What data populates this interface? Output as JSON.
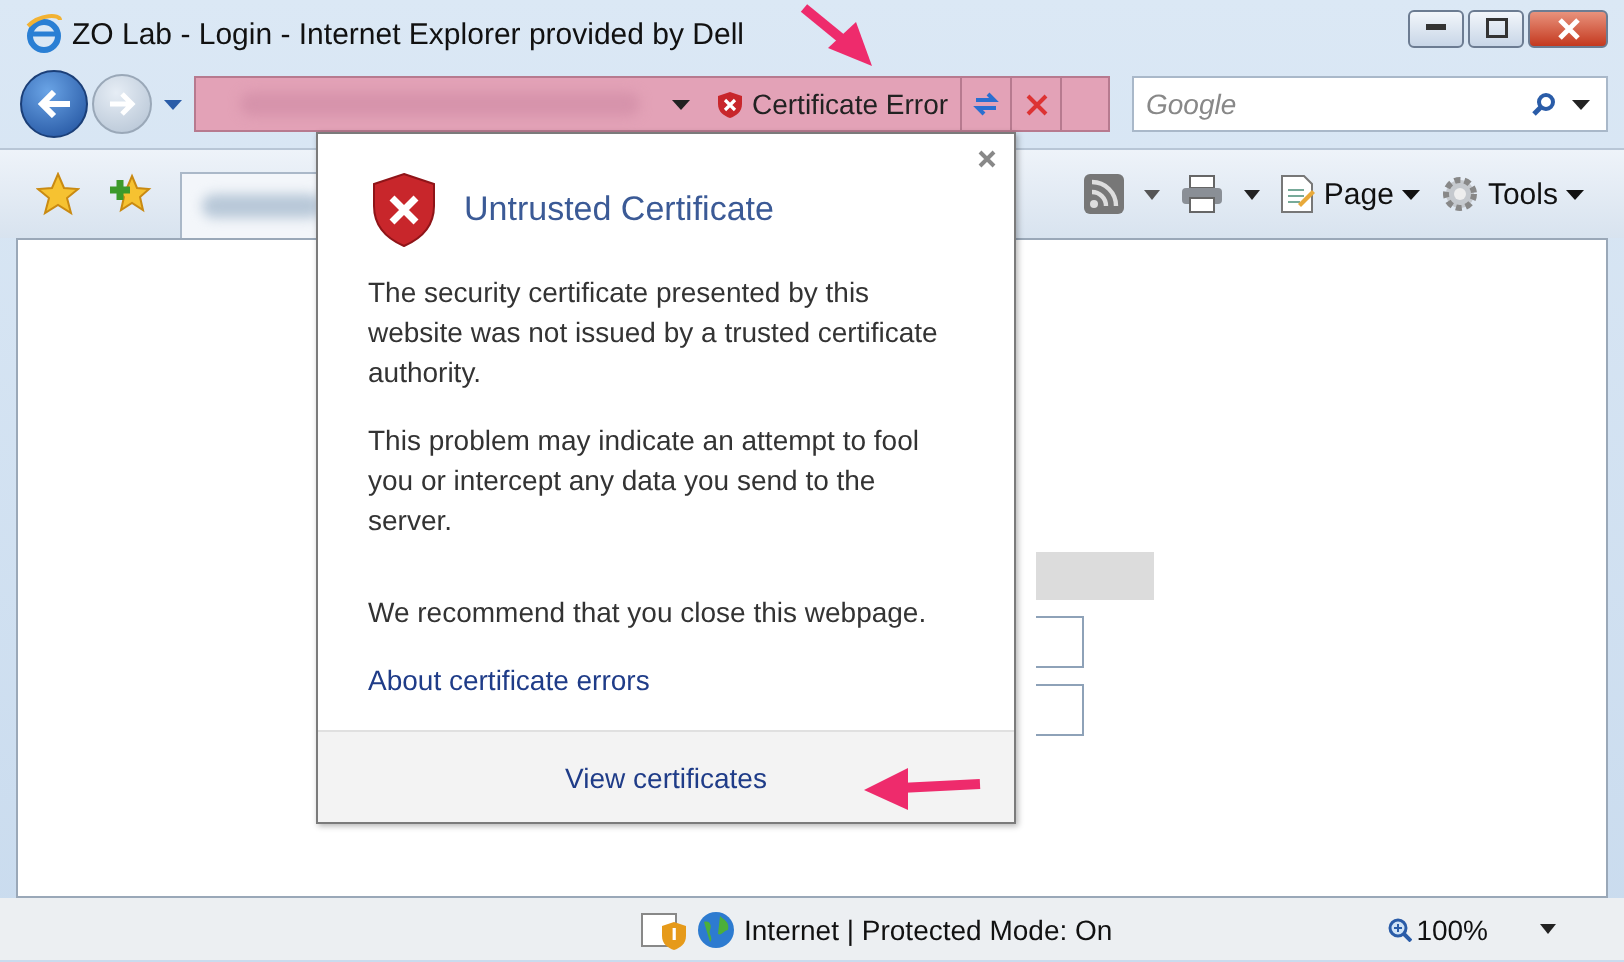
{
  "window": {
    "title": "ZO Lab - Login - Internet Explorer provided by Dell"
  },
  "address_bar": {
    "certificate_status": "Certificate Error"
  },
  "search": {
    "placeholder": "Google"
  },
  "toolbar": {
    "buttons": [
      {
        "label": "Page"
      },
      {
        "label": "Tools"
      }
    ]
  },
  "certificate_popup": {
    "title": "Untrusted Certificate",
    "paragraphs": [
      "The security certificate presented by this website was not issued by a trusted certificate authority.",
      "This problem may indicate an attempt to fool you or intercept any data you send to the server.",
      "We recommend that you close this webpage."
    ],
    "link": "About certificate errors",
    "footer_link": "View certificates"
  },
  "status_bar": {
    "zone": "Internet | Protected Mode: On",
    "zoom": "100%"
  }
}
